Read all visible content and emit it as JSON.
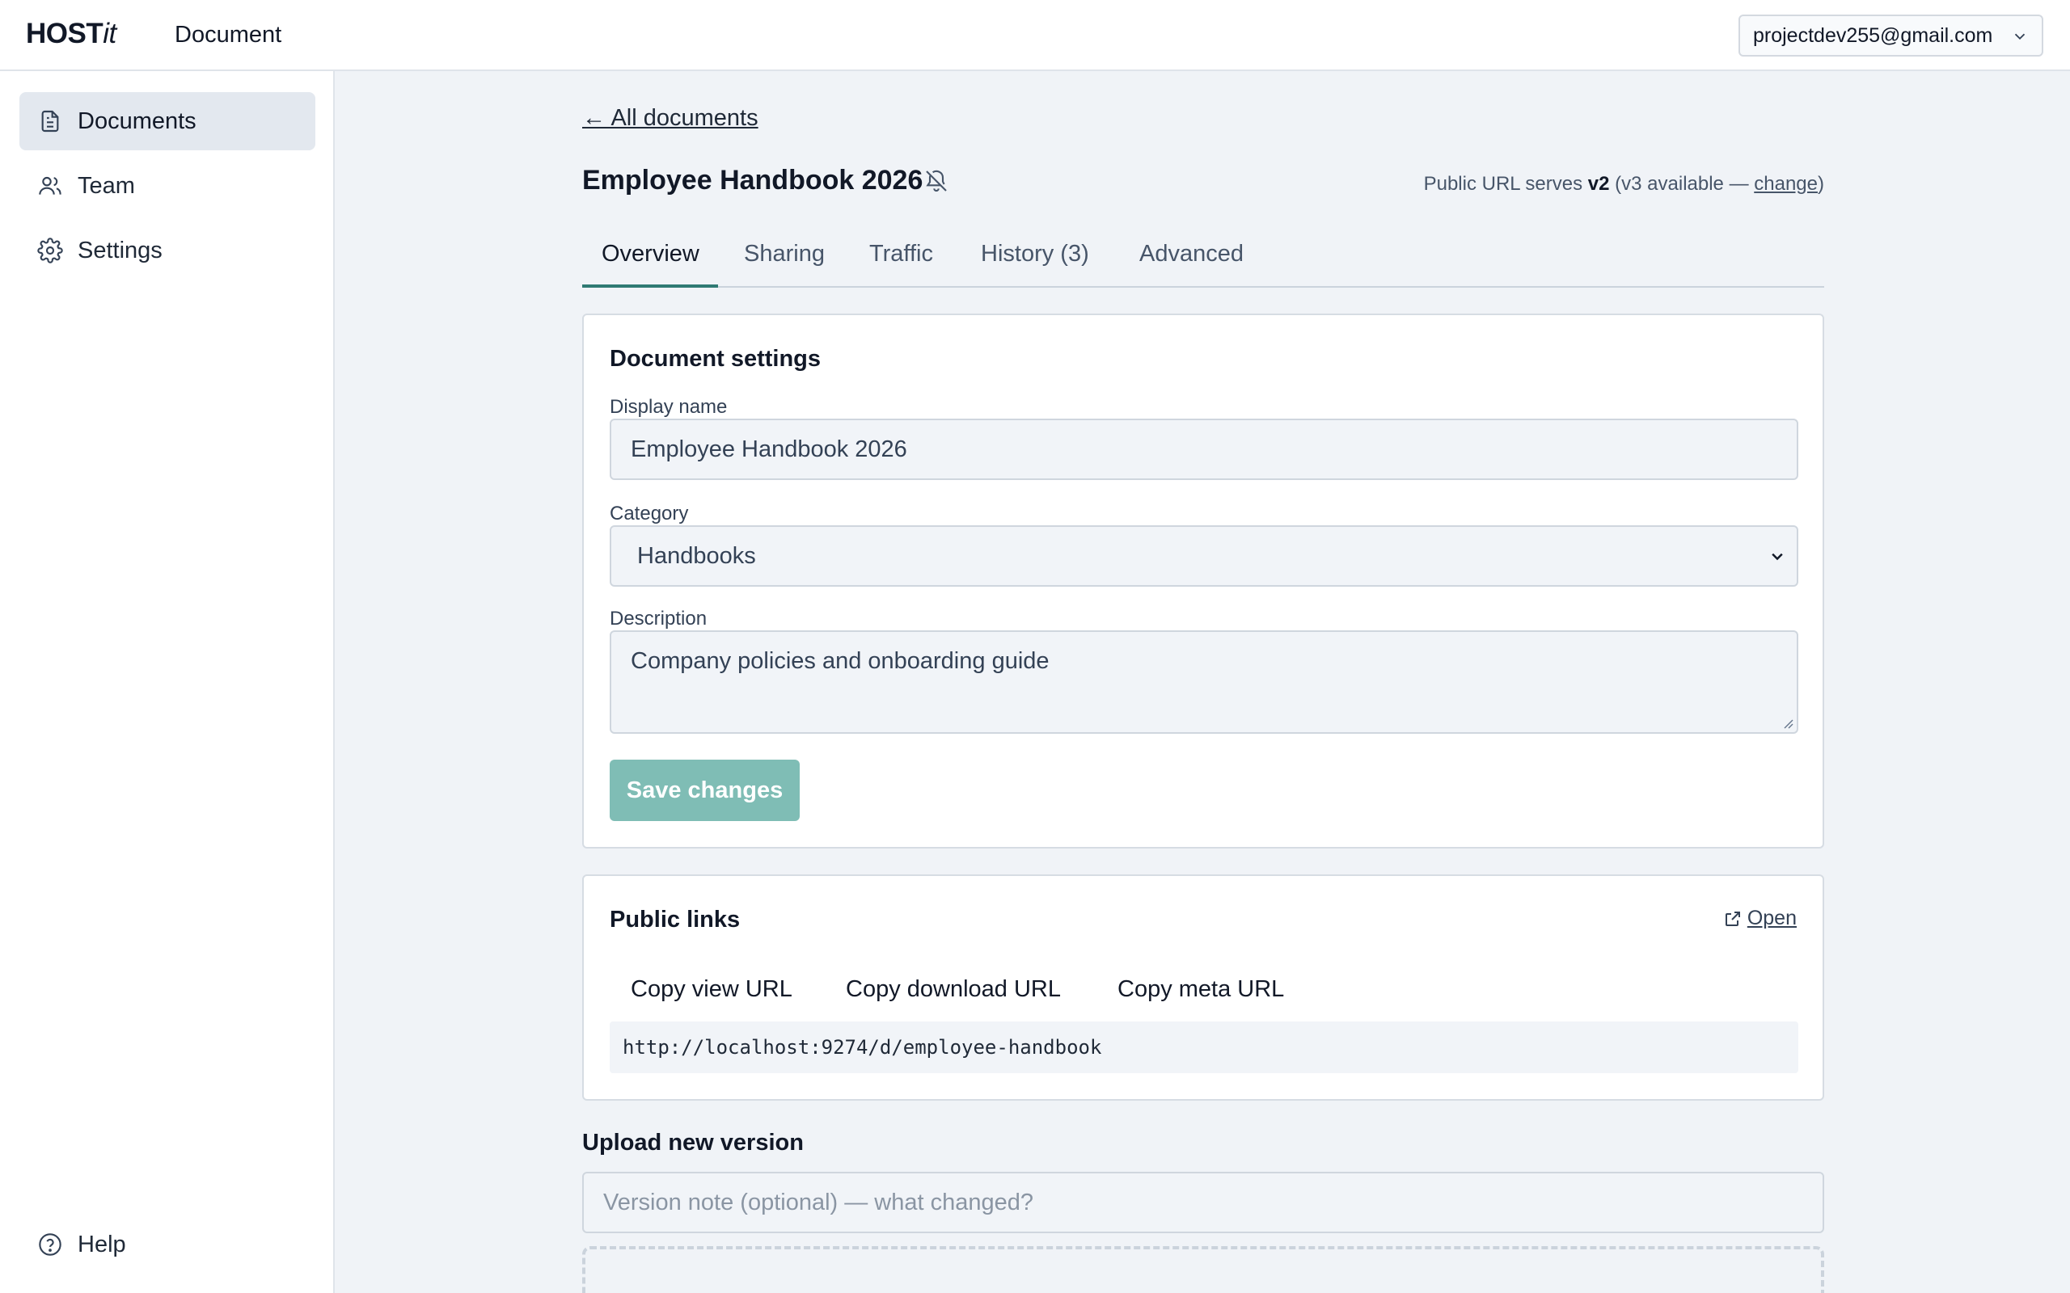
{
  "app": {
    "logo_main": "HOST",
    "logo_italic": "it",
    "section_title": "Document"
  },
  "account": {
    "email": "projectdev255@gmail.com"
  },
  "sidebar": {
    "items": [
      {
        "label": "Documents",
        "icon": "document-icon",
        "active": true
      },
      {
        "label": "Team",
        "icon": "users-icon",
        "active": false
      },
      {
        "label": "Settings",
        "icon": "gear-icon",
        "active": false
      }
    ],
    "help_label": "Help"
  },
  "header": {
    "back_link": "← All documents",
    "doc_title": "Employee Handbook 2026",
    "public_url": {
      "prefix": "Public URL serves",
      "current_version": "v2",
      "available": "(v3 available —",
      "change_label": "change",
      "suffix": ")"
    }
  },
  "tabs": [
    {
      "label": "Overview",
      "active": true
    },
    {
      "label": "Sharing",
      "active": false
    },
    {
      "label": "Traffic",
      "active": false
    },
    {
      "label": "History (3)",
      "active": false
    },
    {
      "label": "Advanced",
      "active": false
    }
  ],
  "settings_card": {
    "title": "Document settings",
    "display_name_label": "Display name",
    "display_name_value": "Employee Handbook 2026",
    "category_label": "Category",
    "category_value": "Handbooks",
    "description_label": "Description",
    "description_value": "Company policies and onboarding guide",
    "save_label": "Save changes"
  },
  "links_card": {
    "title": "Public links",
    "open_label": "Open",
    "copy_view": "Copy view URL",
    "copy_download": "Copy download URL",
    "copy_meta": "Copy meta URL",
    "url": "http://localhost:9274/d/employee-handbook"
  },
  "upload": {
    "title": "Upload new version",
    "version_note_placeholder": "Version note (optional) — what changed?"
  },
  "colors": {
    "accent": "#2f7a73",
    "save_button": "#7fbdb5",
    "background": "#f0f3f7"
  }
}
